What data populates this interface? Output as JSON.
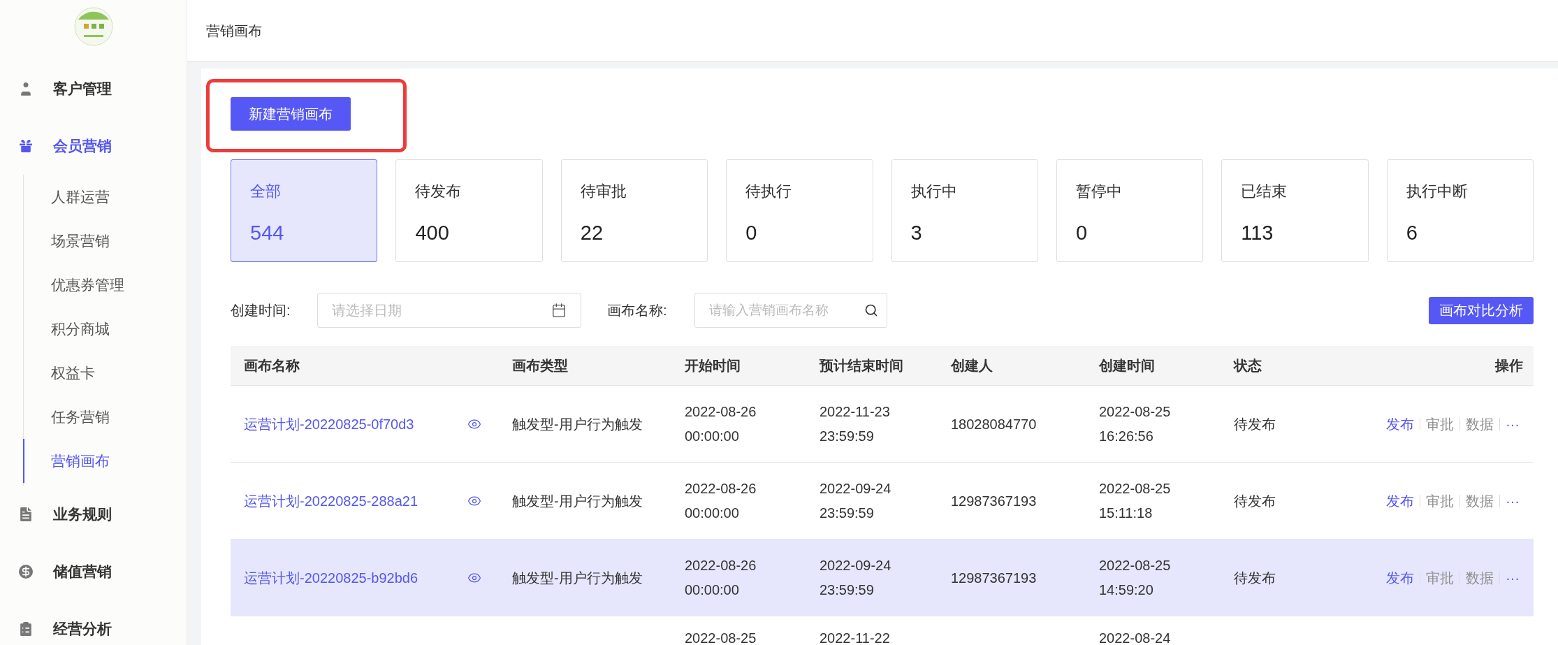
{
  "header": {
    "title": "营销画布"
  },
  "sidebar": {
    "items": [
      {
        "label": "客户管理",
        "selected": false
      },
      {
        "label": "会员营销",
        "selected": true,
        "children": [
          {
            "label": "人群运营",
            "selected": false
          },
          {
            "label": "场景营销",
            "selected": false
          },
          {
            "label": "优惠券管理",
            "selected": false
          },
          {
            "label": "积分商城",
            "selected": false
          },
          {
            "label": "权益卡",
            "selected": false
          },
          {
            "label": "任务营销",
            "selected": false
          },
          {
            "label": "营销画布",
            "selected": true
          }
        ]
      },
      {
        "label": "业务规则",
        "selected": false
      },
      {
        "label": "储值营销",
        "selected": false
      },
      {
        "label": "经营分析",
        "selected": false
      }
    ]
  },
  "new_button": {
    "label": "新建营销画布",
    "highlighted": true
  },
  "status_cards": [
    {
      "label": "全部",
      "count": "544",
      "selected": true
    },
    {
      "label": "待发布",
      "count": "400",
      "selected": false
    },
    {
      "label": "待审批",
      "count": "22",
      "selected": false
    },
    {
      "label": "待执行",
      "count": "0",
      "selected": false
    },
    {
      "label": "执行中",
      "count": "3",
      "selected": false
    },
    {
      "label": "暂停中",
      "count": "0",
      "selected": false
    },
    {
      "label": "已结束",
      "count": "113",
      "selected": false
    },
    {
      "label": "执行中断",
      "count": "6",
      "selected": false
    }
  ],
  "filters": {
    "created_label": "创建时间:",
    "date_placeholder": "请选择日期",
    "name_label": "画布名称:",
    "name_placeholder": "请输入营销画布名称"
  },
  "compare_button": "画布对比分析",
  "table": {
    "columns": [
      "画布名称",
      "画布类型",
      "开始时间",
      "预计结束时间",
      "创建人",
      "创建时间",
      "状态",
      "操作"
    ],
    "rows": [
      {
        "selected": false,
        "name": "运营计划-20220825-0f70d3",
        "type": "触发型-用户行为触发",
        "start": [
          "2022-08-26",
          "00:00:00"
        ],
        "end": [
          "2022-11-23",
          "23:59:59"
        ],
        "creator": "18028084770",
        "created": [
          "2022-08-25",
          "16:26:56"
        ],
        "status": "待发布",
        "actions": [
          {
            "label": "发布",
            "disabled": false
          },
          {
            "label": "审批",
            "disabled": true
          },
          {
            "label": "数据",
            "disabled": true
          },
          {
            "label": "···",
            "disabled": false
          }
        ]
      },
      {
        "selected": false,
        "name": "运营计划-20220825-288a21",
        "type": "触发型-用户行为触发",
        "start": [
          "2022-08-26",
          "00:00:00"
        ],
        "end": [
          "2022-09-24",
          "23:59:59"
        ],
        "creator": "12987367193",
        "created": [
          "2022-08-25",
          "15:11:18"
        ],
        "status": "待发布",
        "actions": [
          {
            "label": "发布",
            "disabled": false
          },
          {
            "label": "审批",
            "disabled": true
          },
          {
            "label": "数据",
            "disabled": true
          },
          {
            "label": "···",
            "disabled": false
          }
        ]
      },
      {
        "selected": true,
        "name": "运营计划-20220825-b92bd6",
        "type": "触发型-用户行为触发",
        "start": [
          "2022-08-26",
          "00:00:00"
        ],
        "end": [
          "2022-09-24",
          "23:59:59"
        ],
        "creator": "12987367193",
        "created": [
          "2022-08-25",
          "14:59:20"
        ],
        "status": "待发布",
        "actions": [
          {
            "label": "发布",
            "disabled": false
          },
          {
            "label": "审批",
            "disabled": true
          },
          {
            "label": "数据",
            "disabled": true
          },
          {
            "label": "···",
            "disabled": false
          }
        ]
      },
      {
        "selected": false,
        "start": [
          "2022-08-25"
        ],
        "end": [
          "2022-11-22"
        ],
        "created": [
          "2022-08-24"
        ]
      }
    ]
  }
}
